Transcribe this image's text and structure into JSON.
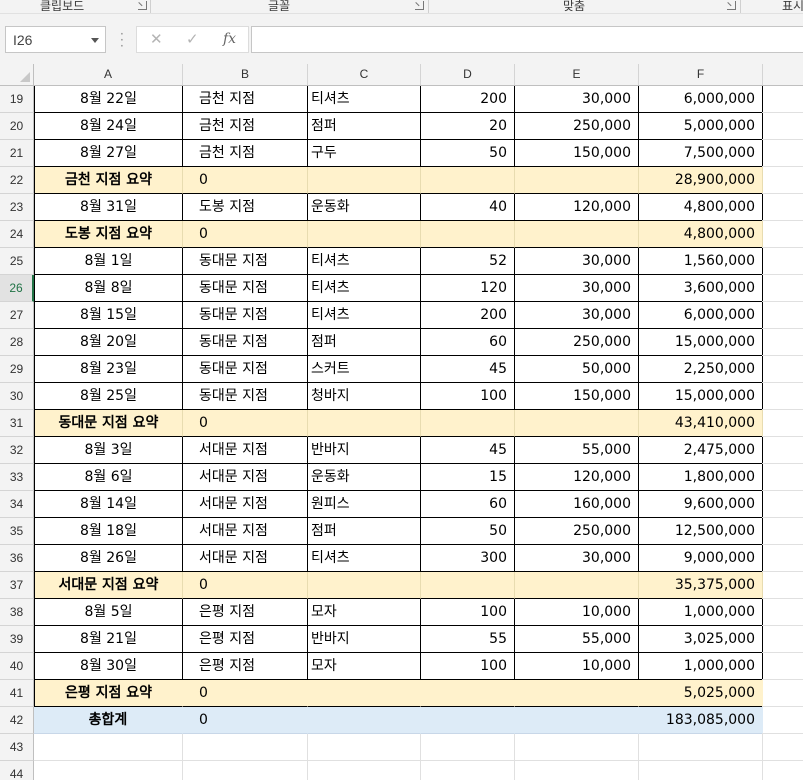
{
  "ribbon": {
    "groups": [
      "클립보드",
      "글꼴",
      "맞춤",
      "표시"
    ]
  },
  "formula_bar": {
    "name_box": "I26",
    "cancel_icon": "✕",
    "enter_icon": "✓",
    "fx_label": "fx",
    "formula": ""
  },
  "columns": [
    "A",
    "B",
    "C",
    "D",
    "E",
    "F"
  ],
  "active_row": "26",
  "rows": [
    {
      "num": "19",
      "kind": "data",
      "cells": [
        "8월 22일",
        "금천 지점",
        "티셔츠",
        "200",
        "30,000",
        "6,000,000"
      ]
    },
    {
      "num": "20",
      "kind": "data",
      "cells": [
        "8월 24일",
        "금천 지점",
        "점퍼",
        "20",
        "250,000",
        "5,000,000"
      ]
    },
    {
      "num": "21",
      "kind": "data",
      "cells": [
        "8월 27일",
        "금천 지점",
        "구두",
        "50",
        "150,000",
        "7,500,000"
      ]
    },
    {
      "num": "22",
      "kind": "summary",
      "cells": [
        "금천 지점 요약",
        "0",
        "",
        "",
        "",
        "28,900,000"
      ]
    },
    {
      "num": "23",
      "kind": "data",
      "cells": [
        "8월 31일",
        "도봉 지점",
        "운동화",
        "40",
        "120,000",
        "4,800,000"
      ]
    },
    {
      "num": "24",
      "kind": "summary",
      "cells": [
        "도봉 지점 요약",
        "0",
        "",
        "",
        "",
        "4,800,000"
      ]
    },
    {
      "num": "25",
      "kind": "data",
      "cells": [
        "8월 1일",
        "동대문 지점",
        "티셔츠",
        "52",
        "30,000",
        "1,560,000"
      ]
    },
    {
      "num": "26",
      "kind": "data",
      "cells": [
        "8월 8일",
        "동대문 지점",
        "티셔츠",
        "120",
        "30,000",
        "3,600,000"
      ]
    },
    {
      "num": "27",
      "kind": "data",
      "cells": [
        "8월 15일",
        "동대문 지점",
        "티셔츠",
        "200",
        "30,000",
        "6,000,000"
      ]
    },
    {
      "num": "28",
      "kind": "data",
      "cells": [
        "8월 20일",
        "동대문 지점",
        "점퍼",
        "60",
        "250,000",
        "15,000,000"
      ]
    },
    {
      "num": "29",
      "kind": "data",
      "cells": [
        "8월 23일",
        "동대문 지점",
        "스커트",
        "45",
        "50,000",
        "2,250,000"
      ]
    },
    {
      "num": "30",
      "kind": "data",
      "cells": [
        "8월 25일",
        "동대문 지점",
        "청바지",
        "100",
        "150,000",
        "15,000,000"
      ]
    },
    {
      "num": "31",
      "kind": "summary",
      "cells": [
        "동대문 지점 요약",
        "0",
        "",
        "",
        "",
        "43,410,000"
      ]
    },
    {
      "num": "32",
      "kind": "data",
      "cells": [
        "8월 3일",
        "서대문 지점",
        "반바지",
        "45",
        "55,000",
        "2,475,000"
      ]
    },
    {
      "num": "33",
      "kind": "data",
      "cells": [
        "8월 6일",
        "서대문 지점",
        "운동화",
        "15",
        "120,000",
        "1,800,000"
      ]
    },
    {
      "num": "34",
      "kind": "data",
      "cells": [
        "8월 14일",
        "서대문 지점",
        "원피스",
        "60",
        "160,000",
        "9,600,000"
      ]
    },
    {
      "num": "35",
      "kind": "data",
      "cells": [
        "8월 18일",
        "서대문 지점",
        "점퍼",
        "50",
        "250,000",
        "12,500,000"
      ]
    },
    {
      "num": "36",
      "kind": "data",
      "cells": [
        "8월 26일",
        "서대문 지점",
        "티셔츠",
        "300",
        "30,000",
        "9,000,000"
      ]
    },
    {
      "num": "37",
      "kind": "summary",
      "cells": [
        "서대문 지점 요약",
        "0",
        "",
        "",
        "",
        "35,375,000"
      ]
    },
    {
      "num": "38",
      "kind": "data",
      "cells": [
        "8월 5일",
        "은평 지점",
        "모자",
        "100",
        "10,000",
        "1,000,000"
      ]
    },
    {
      "num": "39",
      "kind": "data",
      "cells": [
        "8월 21일",
        "은평 지점",
        "반바지",
        "55",
        "55,000",
        "3,025,000"
      ]
    },
    {
      "num": "40",
      "kind": "data",
      "cells": [
        "8월 30일",
        "은평 지점",
        "모자",
        "100",
        "10,000",
        "1,000,000"
      ]
    },
    {
      "num": "41",
      "kind": "summary_banded",
      "cells": [
        "은평 지점 요약",
        "0",
        "",
        "",
        "",
        "5,025,000"
      ]
    },
    {
      "num": "42",
      "kind": "grand",
      "cells": [
        "총합계",
        "0",
        "",
        "",
        "",
        "183,085,000"
      ]
    },
    {
      "num": "43",
      "kind": "empty",
      "cells": [
        "",
        "",
        "",
        "",
        "",
        ""
      ]
    },
    {
      "num": "44",
      "kind": "empty",
      "cells": [
        "",
        "",
        "",
        "",
        "",
        ""
      ]
    }
  ],
  "colors": {
    "summary_fill": "#fff2cc",
    "grand_total_fill": "#ddebf7",
    "active_accent": "#217346"
  }
}
